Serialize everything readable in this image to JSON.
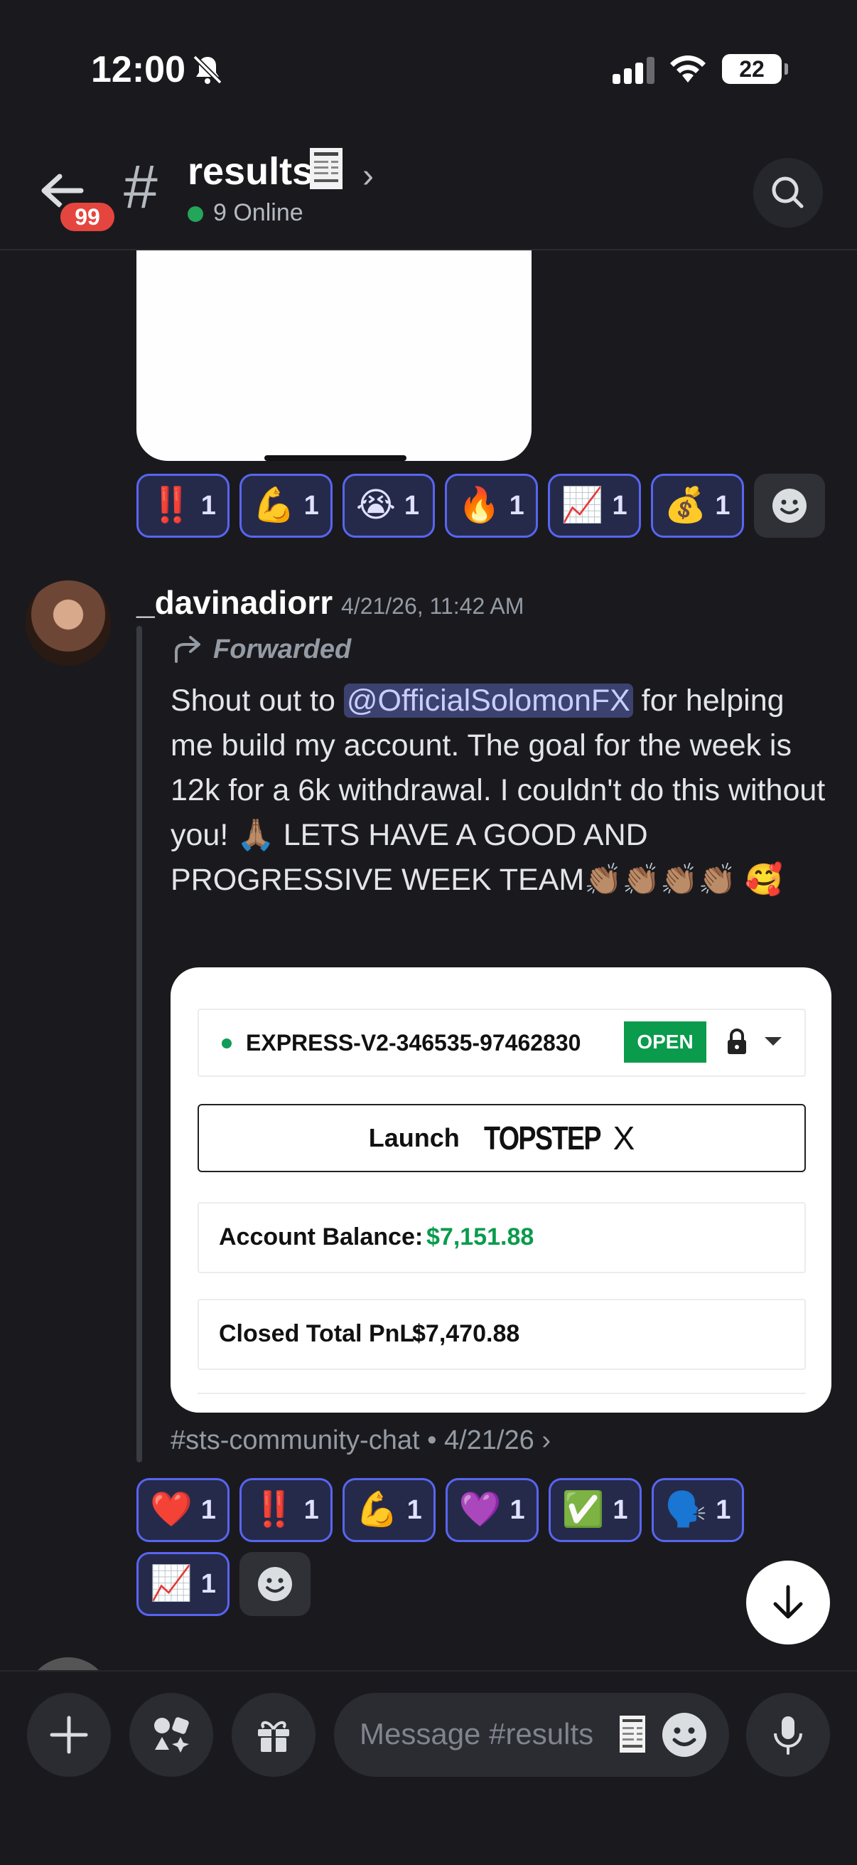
{
  "status_bar": {
    "time": "12:00",
    "battery": "22"
  },
  "header": {
    "back_badge": "99",
    "channel_name": "results",
    "online_count": "9 Online"
  },
  "reactions_top": [
    {
      "emoji": "‼️",
      "count": "1"
    },
    {
      "emoji": "💪",
      "count": "1"
    },
    {
      "emoji": "😭",
      "count": "1"
    },
    {
      "emoji": "🔥",
      "count": "1"
    },
    {
      "emoji": "📈",
      "count": "1"
    },
    {
      "emoji": "💰",
      "count": "1"
    }
  ],
  "message": {
    "author": "_davinadiorr",
    "timestamp": "4/21/26, 11:42 AM",
    "forwarded_label": "Forwarded",
    "text_before_mention": "Shout out to ",
    "mention": "@OfficialSolomonFX",
    "text_after_mention": " for helping me build my account. The goal for the week is 12k for a 6k withdrawal. I couldn't do this without you! 🙏🏽 LETS HAVE A GOOD AND PROGRESSIVE WEEK TEAM👏🏽👏🏽👏🏽👏🏽 🥰",
    "source": "#sts-community-chat • 4/21/26",
    "source_chevron": "›"
  },
  "embed": {
    "account_id": "EXPRESS-V2-346535-97462830",
    "status_badge": "OPEN",
    "launch_label": "Launch",
    "brand": "TOPSTEP",
    "brand_suffix": "X",
    "balance_label": "Account Balance:",
    "balance_value": "$7,151.88",
    "closed_label": "Closed Total PnL:",
    "closed_value": "$7,470.88"
  },
  "reactions_bottom": [
    {
      "emoji": "❤️",
      "count": "1"
    },
    {
      "emoji": "‼️",
      "count": "1"
    },
    {
      "emoji": "💪",
      "count": "1"
    },
    {
      "emoji": "💜",
      "count": "1"
    },
    {
      "emoji": "✅",
      "count": "1"
    },
    {
      "emoji": "🗣️",
      "count": "1"
    },
    {
      "emoji": "📈",
      "count": "1"
    }
  ],
  "composer": {
    "placeholder": "Message #results"
  },
  "colors": {
    "background": "#1a1a1e",
    "accent": "#5865f2",
    "online": "#23a55a",
    "badge": "#e5453f",
    "balance_green": "#0a9b4d"
  },
  "icons": [
    "bell-off-icon",
    "signal-icon",
    "wifi-icon",
    "back-arrow-icon",
    "hash-icon",
    "receipt-icon",
    "chevron-right-icon",
    "search-icon",
    "forward-icon",
    "lock-icon",
    "caret-down-icon",
    "smiley-add-icon",
    "arrow-down-icon",
    "plus-icon",
    "apps-icon",
    "gift-icon",
    "mic-icon"
  ]
}
